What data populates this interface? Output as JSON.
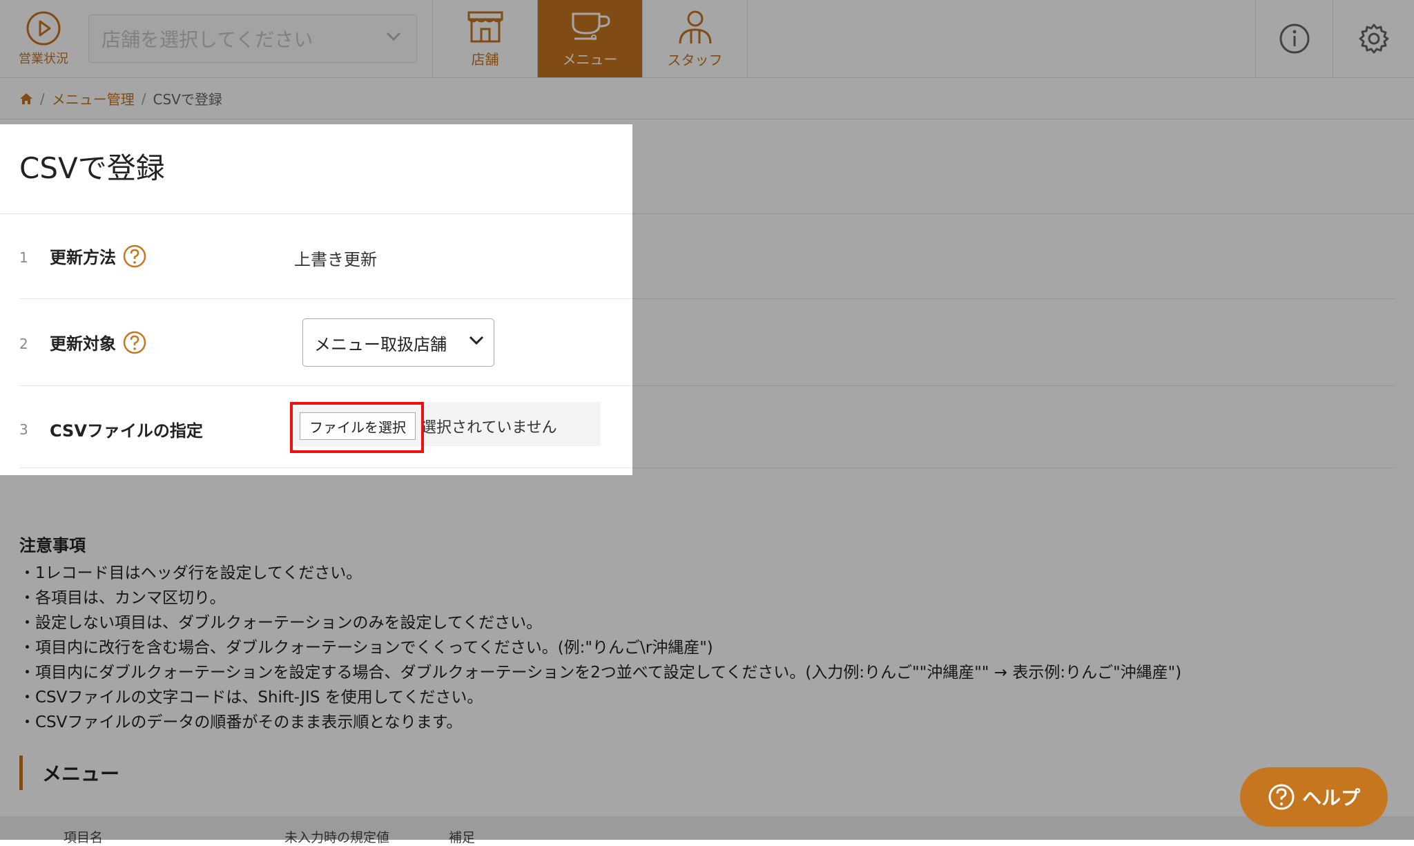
{
  "header": {
    "status_label": "営業状況",
    "store_select_placeholder": "店舗を選択してください",
    "nav": [
      {
        "label": "店舗"
      },
      {
        "label": "メニュー"
      },
      {
        "label": "スタッフ"
      }
    ]
  },
  "breadcrumb": {
    "items": [
      "メニュー管理",
      "CSVで登録"
    ],
    "separator": "/"
  },
  "page": {
    "title": "CSVで登録",
    "rows": [
      {
        "num": "1",
        "label": "更新方法",
        "value": "上書き更新"
      },
      {
        "num": "2",
        "label": "更新対象",
        "value": "メニュー取扱店舗"
      },
      {
        "num": "3",
        "label": "CSVファイルの指定",
        "button": "ファイルを選択",
        "status": "選択されていません"
      }
    ]
  },
  "notes": {
    "title": "注意事項",
    "items": [
      "・1レコード目はヘッダ行を設定してください。",
      "・各項目は、カンマ区切り。",
      "・設定しない項目は、ダブルクォーテーションのみを設定してください。",
      "・項目内に改行を含む場合、ダブルクォーテーションでくくってください。(例:\"りんご\\r沖縄産\")",
      "・項目内にダブルクォーテーションを設定する場合、ダブルクォーテーションを2つ並べて設定してください。(入力例:りんご\"\"沖縄産\"\" → 表示例:りんご\"沖縄産\")",
      "・CSVファイルの文字コードは、Shift-JIS を使用してください。",
      "・CSVファイルのデータの順番がそのまま表示順となります。"
    ]
  },
  "section": {
    "title": "メニュー",
    "columns": [
      "項目名",
      "未入力時の規定値",
      "補足"
    ]
  },
  "help": {
    "label": "ヘルプ"
  },
  "colors": {
    "accent": "#c77620",
    "highlight": "#ee1111"
  }
}
